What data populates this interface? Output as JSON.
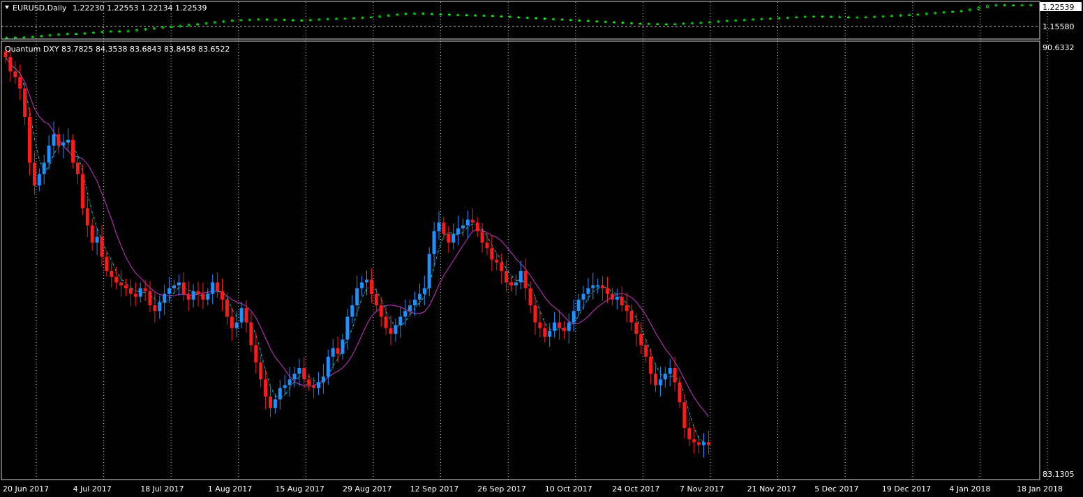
{
  "chart_data": [
    {
      "type": "candlestick",
      "symbol_label": "EURUSD,Daily",
      "ohlc_label": "1.22230 1.22553 1.22134 1.22539",
      "y_ticks": [
        "1.22539",
        "1.15580"
      ],
      "ylim": [
        1.1523,
        1.2285
      ],
      "colors": {
        "candle": "#00ff00",
        "dashed_level": "#c0c0c0",
        "price_box": "#ffffff"
      },
      "series": [
        {
          "values": [
            1.154,
            1.1545,
            1.1548,
            1.156,
            1.158,
            1.16,
            1.1615,
            1.1625,
            1.162,
            1.164,
            1.1655,
            1.167,
            1.168,
            1.1675,
            1.169,
            1.171,
            1.173,
            1.175,
            1.177,
            1.178,
            1.18,
            1.182,
            1.184,
            1.186,
            1.188,
            1.19,
            1.192,
            1.1925,
            1.1935,
            1.194,
            1.193,
            1.1935,
            1.1925,
            1.192,
            1.1915,
            1.193,
            1.194,
            1.195,
            1.1955,
            1.196,
            1.197,
            1.198,
            1.199,
            1.201,
            1.203,
            1.205,
            1.2065,
            1.207,
            1.206,
            1.2055,
            1.205,
            1.204,
            1.2035,
            1.203,
            1.2025,
            1.202,
            1.201,
            1.2,
            1.199,
            1.198,
            1.197,
            1.196,
            1.195,
            1.194,
            1.193,
            1.192,
            1.191,
            1.19,
            1.189,
            1.188,
            1.187,
            1.186,
            1.185,
            1.1845,
            1.184,
            1.1835,
            1.183,
            1.184,
            1.185,
            1.186,
            1.187,
            1.188,
            1.19,
            1.191,
            1.192,
            1.193,
            1.194,
            1.195,
            1.196,
            1.197,
            1.198,
            1.199,
            1.2,
            1.2005,
            1.2,
            1.1995,
            1.199,
            1.198,
            1.1985,
            1.199,
            1.2,
            1.201,
            1.202,
            1.203,
            1.204,
            1.205,
            1.207,
            1.2085,
            1.21,
            1.211,
            1.213,
            1.216,
            1.22,
            1.224,
            1.2255,
            1.225,
            1.2248,
            1.2252,
            1.2254
          ]
        }
      ]
    },
    {
      "type": "candlestick",
      "indicator_label": "Quantum DXY 83.7825 84.3538 83.6843 83.8458 83.6522",
      "y_ticks": [
        "90.6332",
        "83.1305"
      ],
      "ylim": [
        83.1305,
        90.6332
      ],
      "colors": {
        "up": "#1e90ff",
        "down": "#ff1a1a",
        "fast_ma": "#00cccc",
        "slow_ma": "#cc33cc",
        "grid": "#d0d0d0"
      },
      "x_tick_labels": [
        "20 Jun 2017",
        "4 Jul 2017",
        "18 Jul 2017",
        "1 Aug 2017",
        "15 Aug 2017",
        "29 Aug 2017",
        "12 Sep 2017",
        "26 Sep 2017",
        "10 Oct 2017",
        "24 Oct 2017",
        "7 Nov 2017",
        "21 Nov 2017",
        "5 Dec 2017",
        "19 Dec 2017",
        "4 Jan 2018",
        "18 Jan 2018"
      ],
      "x_tick_index": [
        0,
        14,
        28,
        42,
        56,
        70,
        84,
        98,
        112,
        126,
        140,
        154,
        168,
        182,
        196,
        210
      ],
      "series": [
        {
          "name": "",
          "values": [
            90.45,
            90.2,
            90.1,
            89.9,
            89.4,
            88.6,
            88.2,
            88.4,
            88.6,
            88.9,
            89.1,
            88.9,
            88.95,
            89.0,
            88.6,
            88.4,
            87.8,
            87.5,
            87.2,
            87.3,
            86.95,
            86.7,
            86.6,
            86.5,
            86.45,
            86.4,
            86.3,
            86.25,
            86.4,
            86.35,
            86.1,
            86.0,
            86.15,
            86.3,
            86.4,
            86.45,
            86.5,
            86.3,
            86.2,
            86.35,
            86.3,
            86.2,
            86.3,
            86.5,
            86.35,
            86.2,
            85.9,
            85.7,
            85.8,
            86.05,
            85.8,
            85.4,
            85.1,
            84.8,
            84.5,
            84.3,
            84.45,
            84.65,
            84.7,
            84.8,
            84.9,
            85.0,
            84.8,
            84.7,
            84.65,
            84.75,
            84.85,
            85.2,
            85.35,
            85.25,
            85.5,
            85.9,
            86.1,
            86.4,
            86.5,
            86.55,
            86.3,
            86.1,
            85.9,
            85.7,
            85.6,
            85.75,
            85.9,
            86.0,
            86.1,
            86.2,
            86.3,
            86.4,
            87.0,
            87.4,
            87.55,
            87.35,
            87.2,
            87.35,
            87.45,
            87.5,
            87.6,
            87.55,
            87.4,
            87.2,
            87.1,
            86.9,
            86.85,
            86.7,
            86.5,
            86.45,
            86.5,
            86.7,
            86.4,
            86.1,
            85.8,
            85.7,
            85.55,
            85.65,
            85.8,
            85.7,
            85.65,
            85.8,
            86.0,
            86.2,
            86.3,
            86.4,
            86.45,
            86.45,
            86.4,
            86.3,
            86.2,
            86.25,
            86.1,
            86.0,
            85.8,
            85.6,
            85.4,
            85.2,
            84.9,
            84.7,
            84.8,
            84.9,
            85.0,
            84.75,
            84.4,
            83.95,
            83.75,
            83.7,
            83.65,
            83.7,
            83.65
          ]
        }
      ]
    }
  ]
}
